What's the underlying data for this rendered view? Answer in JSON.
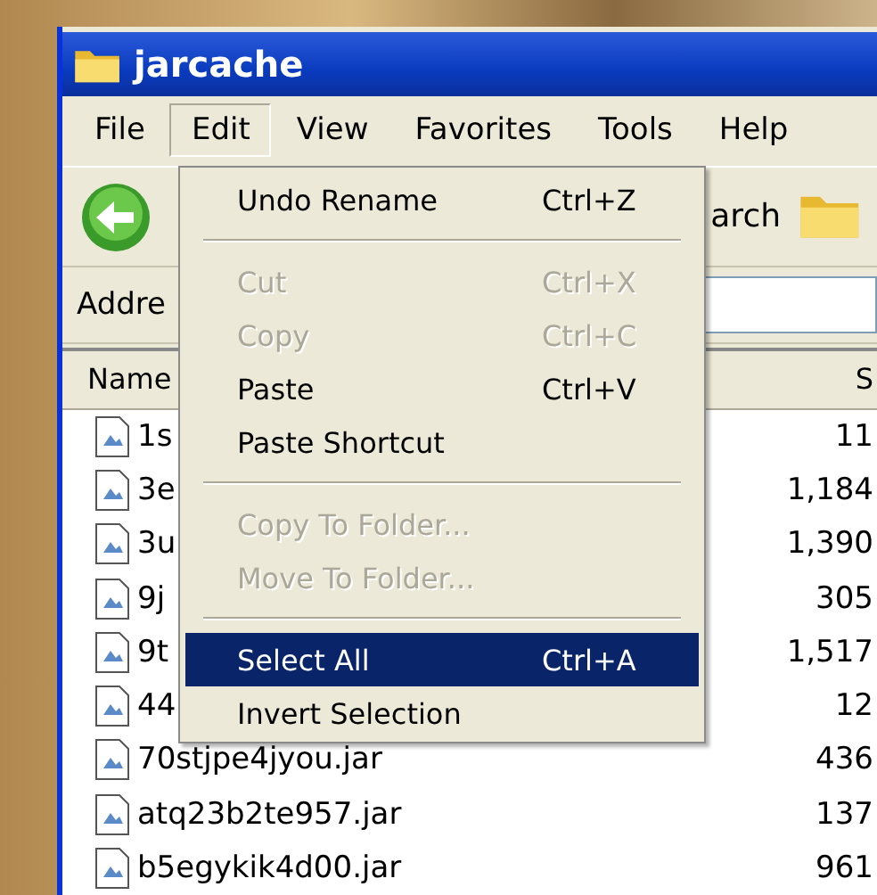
{
  "window": {
    "title": "jarcache"
  },
  "menu_bar": [
    {
      "label": "File",
      "selected": false
    },
    {
      "label": "Edit",
      "selected": true
    },
    {
      "label": "View",
      "selected": false
    },
    {
      "label": "Favorites",
      "selected": false
    },
    {
      "label": "Tools",
      "selected": false
    },
    {
      "label": "Help",
      "selected": false
    }
  ],
  "toolbar": {
    "search_label": "arch"
  },
  "address_bar": {
    "label": "Addre"
  },
  "file_list": {
    "columns": [
      "Name",
      "S"
    ],
    "rows": [
      {
        "name": "1s",
        "size": "11"
      },
      {
        "name": "3e",
        "size": "1,184"
      },
      {
        "name": "3u",
        "size": "1,390"
      },
      {
        "name": "9j",
        "size": "305"
      },
      {
        "name": "9t",
        "size": "1,517"
      },
      {
        "name": "44",
        "size": "12"
      },
      {
        "name": "70stjpe4jyou.jar",
        "size": "436"
      },
      {
        "name": "atq23b2te957.jar",
        "size": "137"
      },
      {
        "name": "b5egykik4d00.jar",
        "size": "961"
      }
    ]
  },
  "edit_menu": [
    {
      "kind": "item",
      "label": "Undo Rename",
      "shortcut": "Ctrl+Z",
      "disabled": false,
      "selected": false
    },
    {
      "kind": "separator"
    },
    {
      "kind": "item",
      "label": "Cut",
      "shortcut": "Ctrl+X",
      "disabled": true,
      "selected": false
    },
    {
      "kind": "item",
      "label": "Copy",
      "shortcut": "Ctrl+C",
      "disabled": true,
      "selected": false
    },
    {
      "kind": "item",
      "label": "Paste",
      "shortcut": "Ctrl+V",
      "disabled": false,
      "selected": false
    },
    {
      "kind": "item",
      "label": "Paste Shortcut",
      "disabled": false,
      "selected": false
    },
    {
      "kind": "separator"
    },
    {
      "kind": "item",
      "label": "Copy To Folder...",
      "disabled": true,
      "selected": false
    },
    {
      "kind": "item",
      "label": "Move To Folder...",
      "disabled": true,
      "selected": false
    },
    {
      "kind": "separator"
    },
    {
      "kind": "item",
      "label": "Select All",
      "shortcut": "Ctrl+A",
      "disabled": false,
      "selected": true
    },
    {
      "kind": "item",
      "label": "Invert Selection",
      "disabled": false,
      "selected": false
    }
  ]
}
